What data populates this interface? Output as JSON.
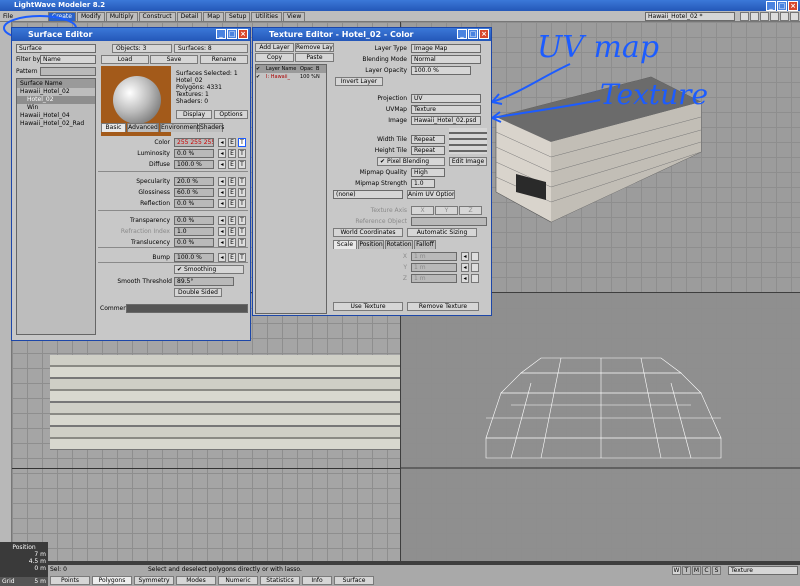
{
  "app": {
    "title": "LightWave Modeler 8.2",
    "main_tabs": [
      "Create",
      "Modify",
      "Multiply",
      "Construct",
      "Detail",
      "Map",
      "Setup",
      "Utilities",
      "View"
    ],
    "file_label": "File",
    "object_name": "Hawaii_Hotel_02 *"
  },
  "surface_editor": {
    "title": "Surface Editor",
    "filter_label": "Filter by",
    "filter_value": "Name",
    "edit_by_value": "Surface",
    "pattern_label": "Pattern",
    "tree_header": "Surface Name",
    "tree": [
      "Hawaii_Hotel_02",
      "Hotel_02",
      "Win",
      "Hawaii_Hotel_04",
      "Hawaii_Hotel_02_Rad"
    ],
    "objects_label": "Objects: 3",
    "surfaces_label": "Surfaces: 8",
    "load": "Load",
    "save": "Save",
    "rename": "Rename",
    "info": [
      "Surfaces Selected: 1",
      "Hotel_02",
      "Polygons: 4331",
      "Textures: 1",
      "Shaders: 0"
    ],
    "display_label": "Display",
    "options_label": "Options",
    "tabs": [
      "Basic",
      "Advanced",
      "Environment",
      "Shaders"
    ],
    "props": [
      {
        "label": "Color",
        "value": "255 255 255"
      },
      {
        "label": "Luminosity",
        "value": "0.0 %"
      },
      {
        "label": "Diffuse",
        "value": "100.0 %"
      },
      {
        "label": "Specularity",
        "value": "20.0 %"
      },
      {
        "label": "Glossiness",
        "value": "60.0 %"
      },
      {
        "label": "Reflection",
        "value": "0.0 %"
      },
      {
        "label": "Transparency",
        "value": "0.0 %"
      },
      {
        "label": "Refraction Index",
        "value": "1.0"
      },
      {
        "label": "Translucency",
        "value": "0.0 %"
      },
      {
        "label": "Bump",
        "value": "100.0 %"
      }
    ],
    "smoothing": "Smoothing",
    "smooth_threshold_label": "Smooth Threshold",
    "smooth_threshold": "89.5°",
    "double_sided": "Double Sided",
    "comment_label": "Comment"
  },
  "texture_editor": {
    "title": "Texture Editor - Hotel_02 - Color",
    "add_layer": "Add Layer",
    "remove_layer": "Remove Layer",
    "copy": "Copy",
    "paste": "Paste",
    "layer_cols": [
      "Layer Name",
      "Opac",
      "B"
    ],
    "layer_row": [
      "I: Hawaii_",
      "100 %",
      "N"
    ],
    "layer_type_label": "Layer Type",
    "layer_type": "Image Map",
    "blending_label": "Blending Mode",
    "blending": "Normal",
    "opacity_label": "Layer Opacity",
    "opacity": "100.0 %",
    "invert_layer": "Invert Layer",
    "projection_label": "Projection",
    "projection": "UV",
    "uvmap_label": "UVMap",
    "uvmap": "Texture",
    "image_label": "Image",
    "image": "Hawaii_Hotel_02.psd",
    "width_tile_label": "Width Tile",
    "width_tile": "Repeat",
    "height_tile_label": "Height Tile",
    "height_tile": "Repeat",
    "pixel_blending": "Pixel Blending",
    "edit_image": "Edit Image",
    "mipmap_quality_label": "Mipmap Quality",
    "mipmap_quality": "High",
    "mipmap_strength_label": "Mipmap Strength",
    "mipmap_strength": "1.0",
    "none": "(none)",
    "anim_uv": "Anim UV Options",
    "texture_axis_label": "Texture Axis",
    "axes": [
      "X",
      "Y",
      "Z"
    ],
    "reference_object_label": "Reference Object",
    "world_coords": "World Coordinates",
    "auto_sizing": "Automatic Sizing",
    "tabs": [
      "Scale",
      "Position",
      "Rotation",
      "Falloff"
    ],
    "scale": [
      {
        "axis": "X",
        "value": "1 m"
      },
      {
        "axis": "Y",
        "value": "1 m"
      },
      {
        "axis": "Z",
        "value": "1 m"
      }
    ],
    "use_texture": "Use Texture",
    "remove_texture": "Remove Texture"
  },
  "annotations": {
    "uvmap": "UV map",
    "texture": "Texture"
  },
  "status": {
    "position_label": "Position",
    "readouts": [
      "7 m",
      "4.5 m",
      "0 m"
    ],
    "grid_label": "Grid",
    "grid_value": "5 m",
    "sel_label": "Sel:",
    "sel_value": "0",
    "message": "Select and deselect polygons directly or with lasso.",
    "buttons": [
      "Points",
      "Polygons",
      "Symmetry",
      "Modes",
      "Numeric",
      "Statistics",
      "Info",
      "Surface"
    ],
    "letters": [
      "W",
      "T",
      "M",
      "C",
      "S"
    ],
    "texture_select": "Texture"
  },
  "colors": {
    "titlebar": "#2b62c8",
    "annotation": "#1c5cff",
    "panel": "#c8c8c8",
    "viewport": "#a5a5a5"
  }
}
